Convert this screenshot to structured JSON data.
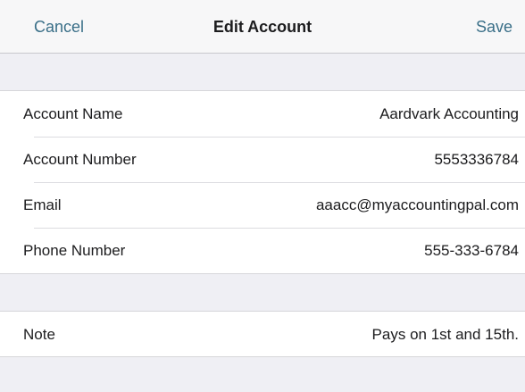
{
  "navbar": {
    "cancel_label": "Cancel",
    "title": "Edit Account",
    "save_label": "Save",
    "accent_color": "#3a6f88"
  },
  "account_fields": [
    {
      "label": "Account Name",
      "value": "Aardvark Accounting"
    },
    {
      "label": "Account Number",
      "value": "5553336784"
    },
    {
      "label": "Email",
      "value": "aaacc@myaccountingpal.com"
    },
    {
      "label": "Phone Number",
      "value": "555-333-6784"
    }
  ],
  "note_field": {
    "label": "Note",
    "value": "Pays on 1st and 15th."
  }
}
